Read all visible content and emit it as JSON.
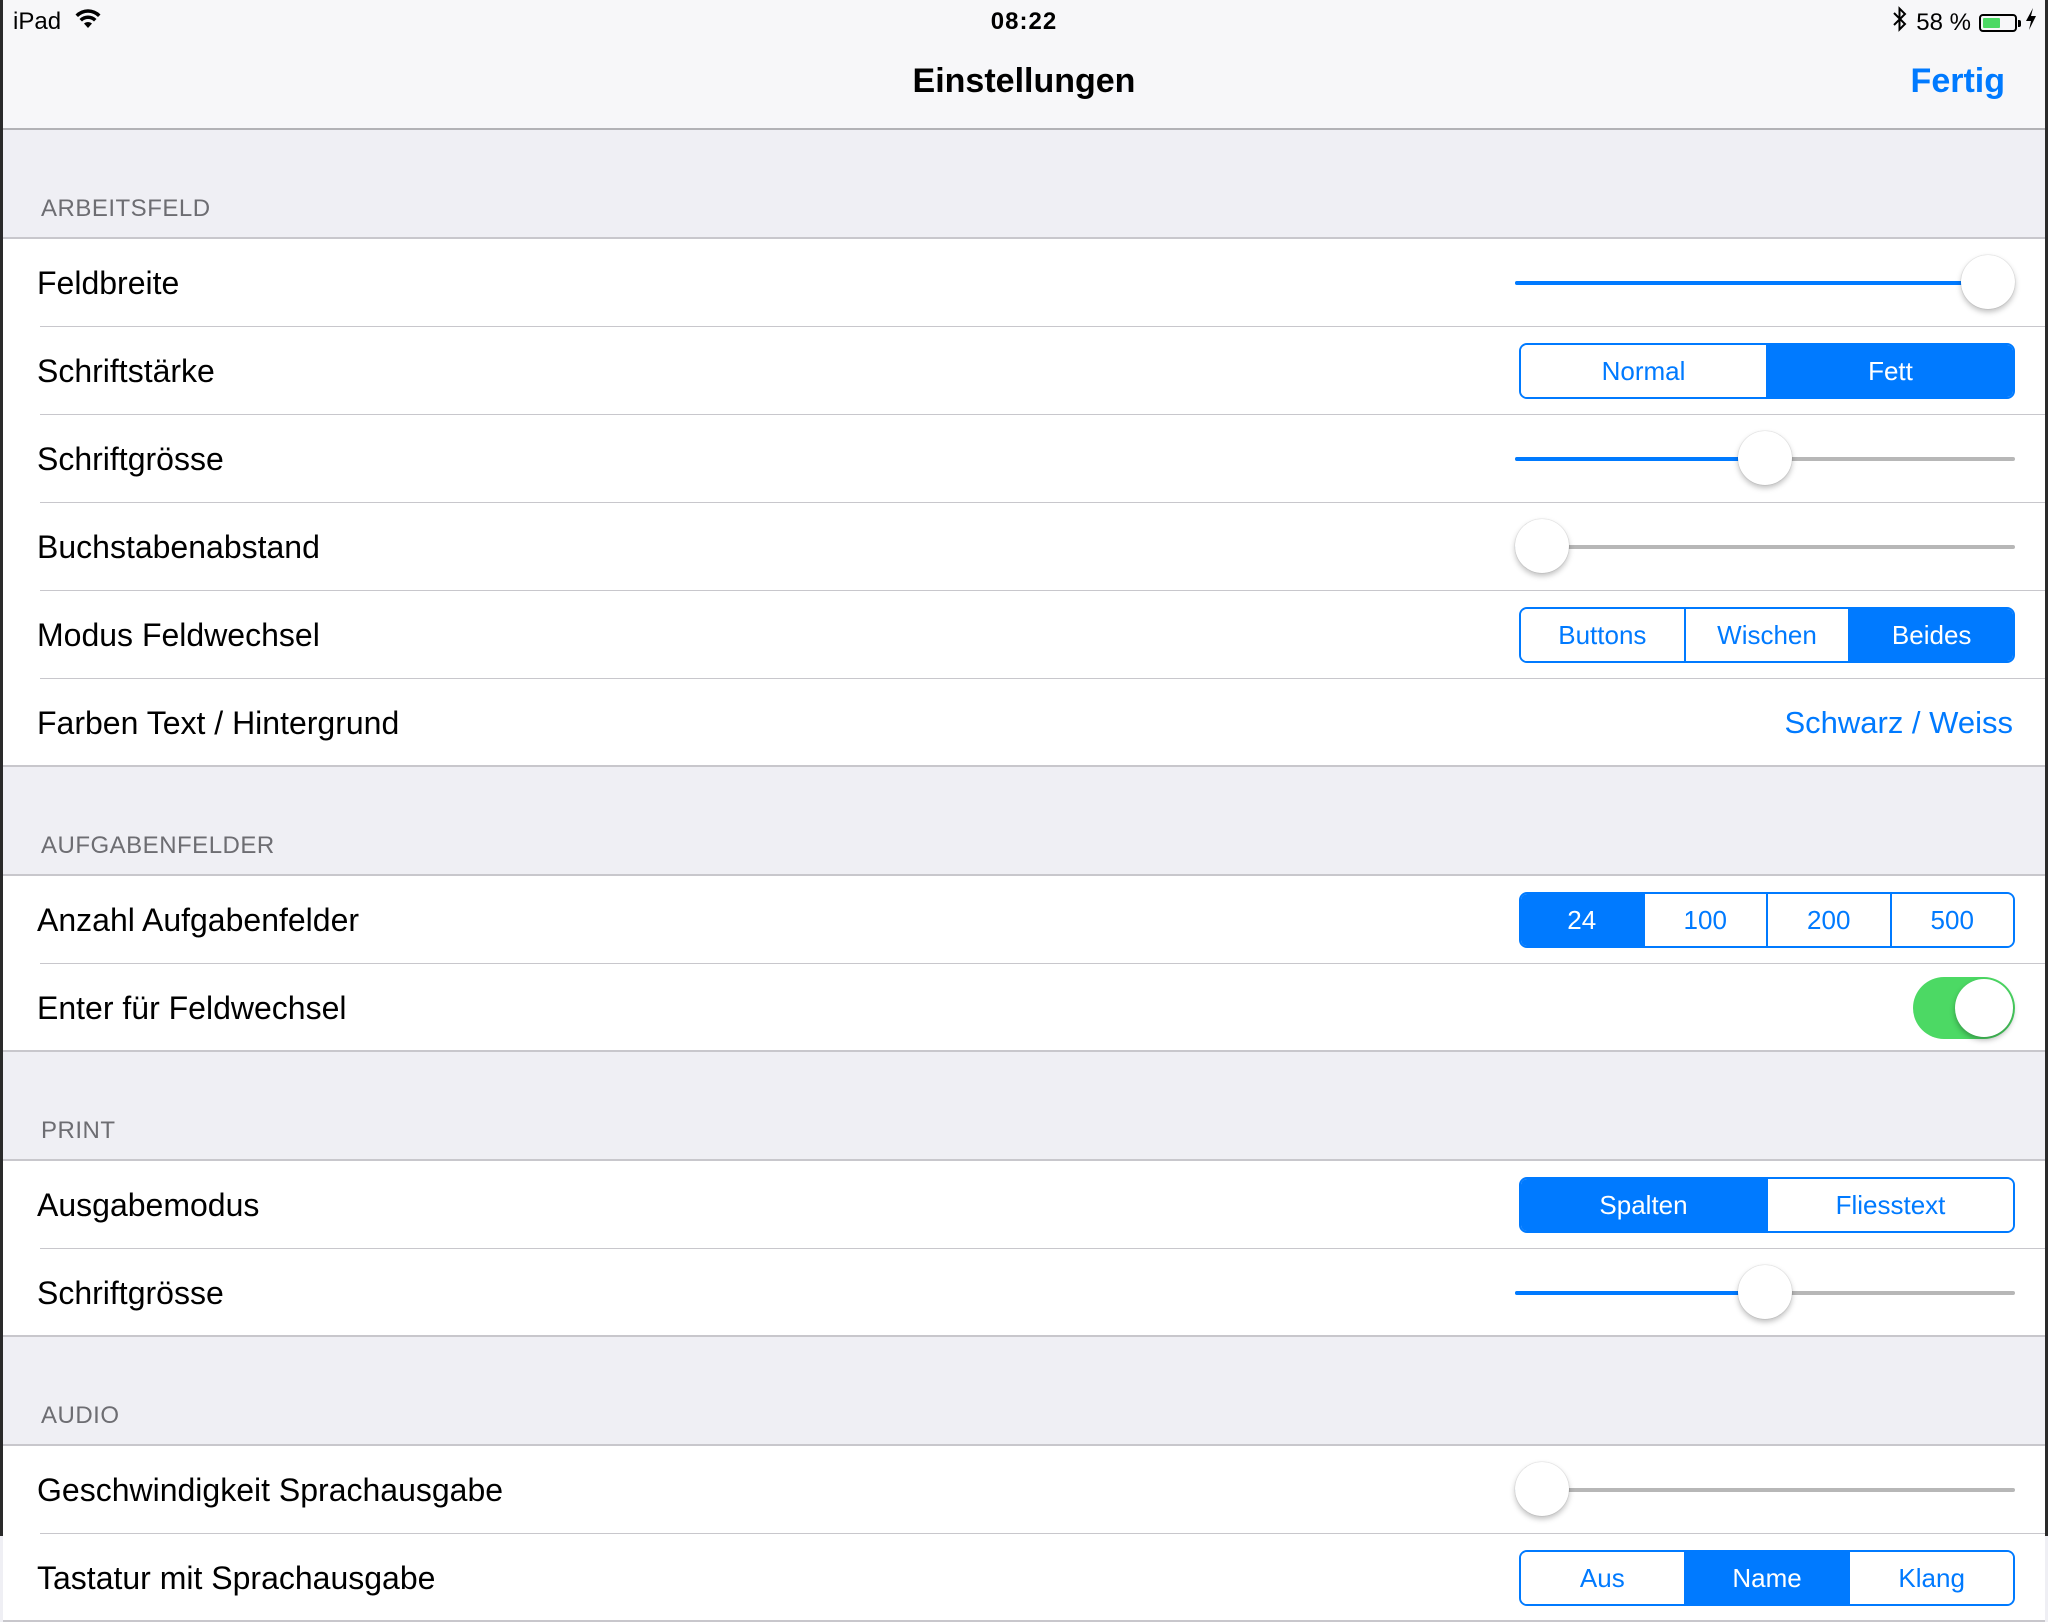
{
  "status_bar": {
    "carrier": "iPad",
    "wifi_icon": "wifi-icon",
    "time": "08:22",
    "bluetooth_icon": "bluetooth-icon",
    "battery_percent_label": "58 %",
    "battery_level": 0.58,
    "charging_icon": "bolt-icon"
  },
  "nav": {
    "title": "Einstellungen",
    "done_label": "Fertig"
  },
  "colors": {
    "accent": "#007aff",
    "toggle_on": "#4cd964",
    "group_bg": "#efeff4",
    "section_text": "#6d6d72"
  },
  "sections": [
    {
      "header": "ARBEITSFELD",
      "rows": [
        {
          "label": "Feldbreite",
          "type": "slider",
          "value": 1.0
        },
        {
          "label": "Schriftstärke",
          "type": "segmented",
          "options": [
            "Normal",
            "Fett"
          ],
          "selected": 1
        },
        {
          "label": "Schriftgrösse",
          "type": "slider",
          "value": 0.5
        },
        {
          "label": "Buchstabenabstand",
          "type": "slider",
          "value": 0.0
        },
        {
          "label": "Modus Feldwechsel",
          "type": "segmented",
          "options": [
            "Buttons",
            "Wischen",
            "Beides"
          ],
          "selected": 2
        },
        {
          "label": "Farben Text / Hintergrund",
          "type": "value",
          "value": "Schwarz / Weiss"
        }
      ]
    },
    {
      "header": "AUFGABENFELDER",
      "rows": [
        {
          "label": "Anzahl Aufgabenfelder",
          "type": "segmented",
          "options": [
            "24",
            "100",
            "200",
            "500"
          ],
          "selected": 0
        },
        {
          "label": "Enter für Feldwechsel",
          "type": "toggle",
          "value": true
        }
      ]
    },
    {
      "header": "PRINT",
      "rows": [
        {
          "label": "Ausgabemodus",
          "type": "segmented",
          "options": [
            "Spalten",
            "Fliesstext"
          ],
          "selected": 0
        },
        {
          "label": "Schriftgrösse",
          "type": "slider",
          "value": 0.5
        }
      ]
    },
    {
      "header": "AUDIO",
      "rows": [
        {
          "label": "Geschwindigkeit Sprachausgabe",
          "type": "slider",
          "value": 0.0
        },
        {
          "label": "Tastatur mit Sprachausgabe",
          "type": "segmented",
          "options": [
            "Aus",
            "Name",
            "Klang"
          ],
          "selected": 1
        }
      ]
    }
  ]
}
